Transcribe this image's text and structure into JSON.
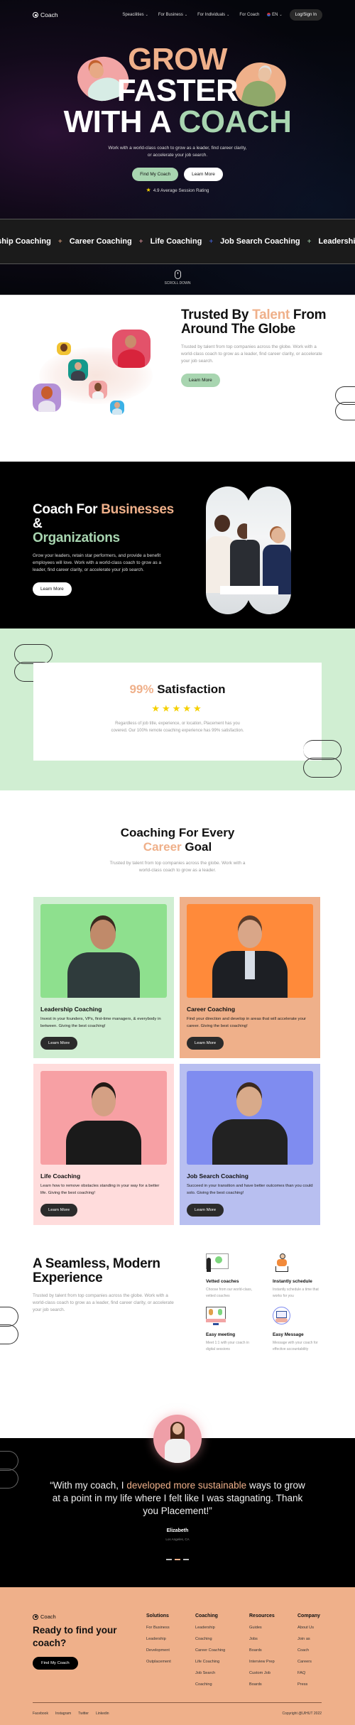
{
  "nav": {
    "brand": "Coach",
    "links": [
      {
        "label": "Speacilities",
        "has_dropdown": true
      },
      {
        "label": "For Business",
        "has_dropdown": true
      },
      {
        "label": "For Individuals",
        "has_dropdown": true
      },
      {
        "label": "For Coach",
        "has_dropdown": false
      }
    ],
    "language": "EN",
    "login_label": "Log/Sign In"
  },
  "hero": {
    "line1": "GROW",
    "line2": "FASTER",
    "line3_prefix": "WITH A",
    "line3_accent": "COACH",
    "subtitle": "Work with a world-class coach to grow as a leader, find career clarity, or accelerate your job search.",
    "primary_button": "Find My Coach",
    "secondary_button": "Learn More",
    "rating_text": "4.9 Average Session Rating"
  },
  "ticker": {
    "items": [
      {
        "label": "Leadership Coaching",
        "plus_color": "#efb08a"
      },
      {
        "label": "Career Coaching",
        "plus_color": "#ef9fa8"
      },
      {
        "label": "Life Coaching",
        "plus_color": "#4a6cf0"
      },
      {
        "label": "Job Search Coaching",
        "plus_color": "#a8d5b0"
      },
      {
        "label": "Leadership Coaching",
        "plus_color": "#efb08a"
      }
    ]
  },
  "scroll_down": "SCROLL DOWN",
  "trusted": {
    "title_before": "Trusted By",
    "title_accent": "Talent",
    "title_after": "From Around The Globe",
    "text": "Trusted by talent from top companies across the globe. Work with a world-class coach to grow as a leader, find career clarity, or accelerate your job search.",
    "button": "Learn More"
  },
  "business": {
    "title_before": "Coach For",
    "title_accent1": "Businesses",
    "title_mid": "&",
    "title_accent2": "Organizations",
    "text": "Grow your leaders, retain star performers, and provide a benefit employees will love. Work with a world-class coach to grow as a leader, find career clarity, or accelerate your job search.",
    "button": "Learn More"
  },
  "satisfaction": {
    "percent": "99%",
    "label": "Satisfaction",
    "stars": 5,
    "stars_text": "★★★★★",
    "text": "Regardless of job title, experience, or location, Placement has you covered. Our 100% remote coaching experience has 99% satisfaction."
  },
  "coaching": {
    "title_line1": "Coaching For Every",
    "title_accent": "Career",
    "title_end": "Goal",
    "subtitle": "Trusted by talent from top companies across the globe. Work with a world-class coach to grow as a leader.",
    "cards": [
      {
        "title": "Leadership Coaching",
        "text": "Invest in your founders, VPs, first-time managers, & everybody in between. Giving the best coaching!",
        "button": "Learn More",
        "bg": "#d0eed2",
        "img_bg": "#8ee08e"
      },
      {
        "title": "Career Coaching",
        "text": "Find your direction and develop in areas that will accelerate your career. Giving the best coaching!",
        "button": "Learn More",
        "bg": "#efb08a",
        "img_bg": "#ff8a3a"
      },
      {
        "title": "Life Coaching",
        "text": "Learn how to remove obstacles standing in your way for a better life. Giving the best coaching!",
        "button": "Learn More",
        "bg": "#ffdcdc",
        "img_bg": "#f7a0a4"
      },
      {
        "title": "Job Search Coaching",
        "text": "Succeed in your transition and have better outcomes than you could solo. Giving the best coaching!",
        "button": "Learn More",
        "bg": "#b8bff0",
        "img_bg": "#7f8cf0"
      }
    ]
  },
  "seamless": {
    "title": "A Seamless, Modern Experience",
    "text": "Trusted by talent from top companies across the globe. Work with a world-class coach to grow as a leader, find career clarity, or accelerate your job search.",
    "features": [
      {
        "icon": "vetted-coaches-icon",
        "title": "Vetted coaches",
        "text": "Choose from our world-class, vetted coaches"
      },
      {
        "icon": "schedule-icon",
        "title": "Instantly schedule",
        "text": "Instantly schedule a time that works for you"
      },
      {
        "icon": "meeting-icon",
        "title": "Easy meeting",
        "text": "Meet 1:1 with your coach in digital sessions"
      },
      {
        "icon": "message-icon",
        "title": "Easy Message",
        "text": "Message with your coach for effective accountability"
      }
    ]
  },
  "testimonial": {
    "quote_before": "“With my coach, I",
    "quote_accent": "developed more sustainable",
    "quote_after": "ways to grow at a point in my life where I felt like I was stagnating. Thank you Placement!”",
    "name": "Elizabeth",
    "location": "Los Angeles, CA",
    "slides": 3,
    "active_slide": 2
  },
  "footer": {
    "brand": "Coach",
    "headline": "Ready to find your coach?",
    "button": "Find My Coach",
    "columns": [
      {
        "title": "Solutions",
        "links": [
          "For Business",
          "Leadership",
          "Development",
          "Outplacement"
        ]
      },
      {
        "title": "Coaching",
        "links": [
          "Leadership",
          "Coaching",
          "Career Coaching",
          "Life Coaching",
          "Job Search",
          "Coaching"
        ]
      },
      {
        "title": "Resources",
        "links": [
          "Guides",
          "Jobs",
          "Boards",
          "Interview Prep",
          "Custom Job",
          "Boards"
        ]
      },
      {
        "title": "Company",
        "links": [
          "About Us",
          "Join as",
          "Coach",
          "Careers",
          "FAQ",
          "Press"
        ]
      }
    ],
    "social": [
      "Facebook",
      "Instagram",
      "Twitter",
      "Linkedin"
    ],
    "copyright": "Copyright @UIHUT 2022"
  }
}
